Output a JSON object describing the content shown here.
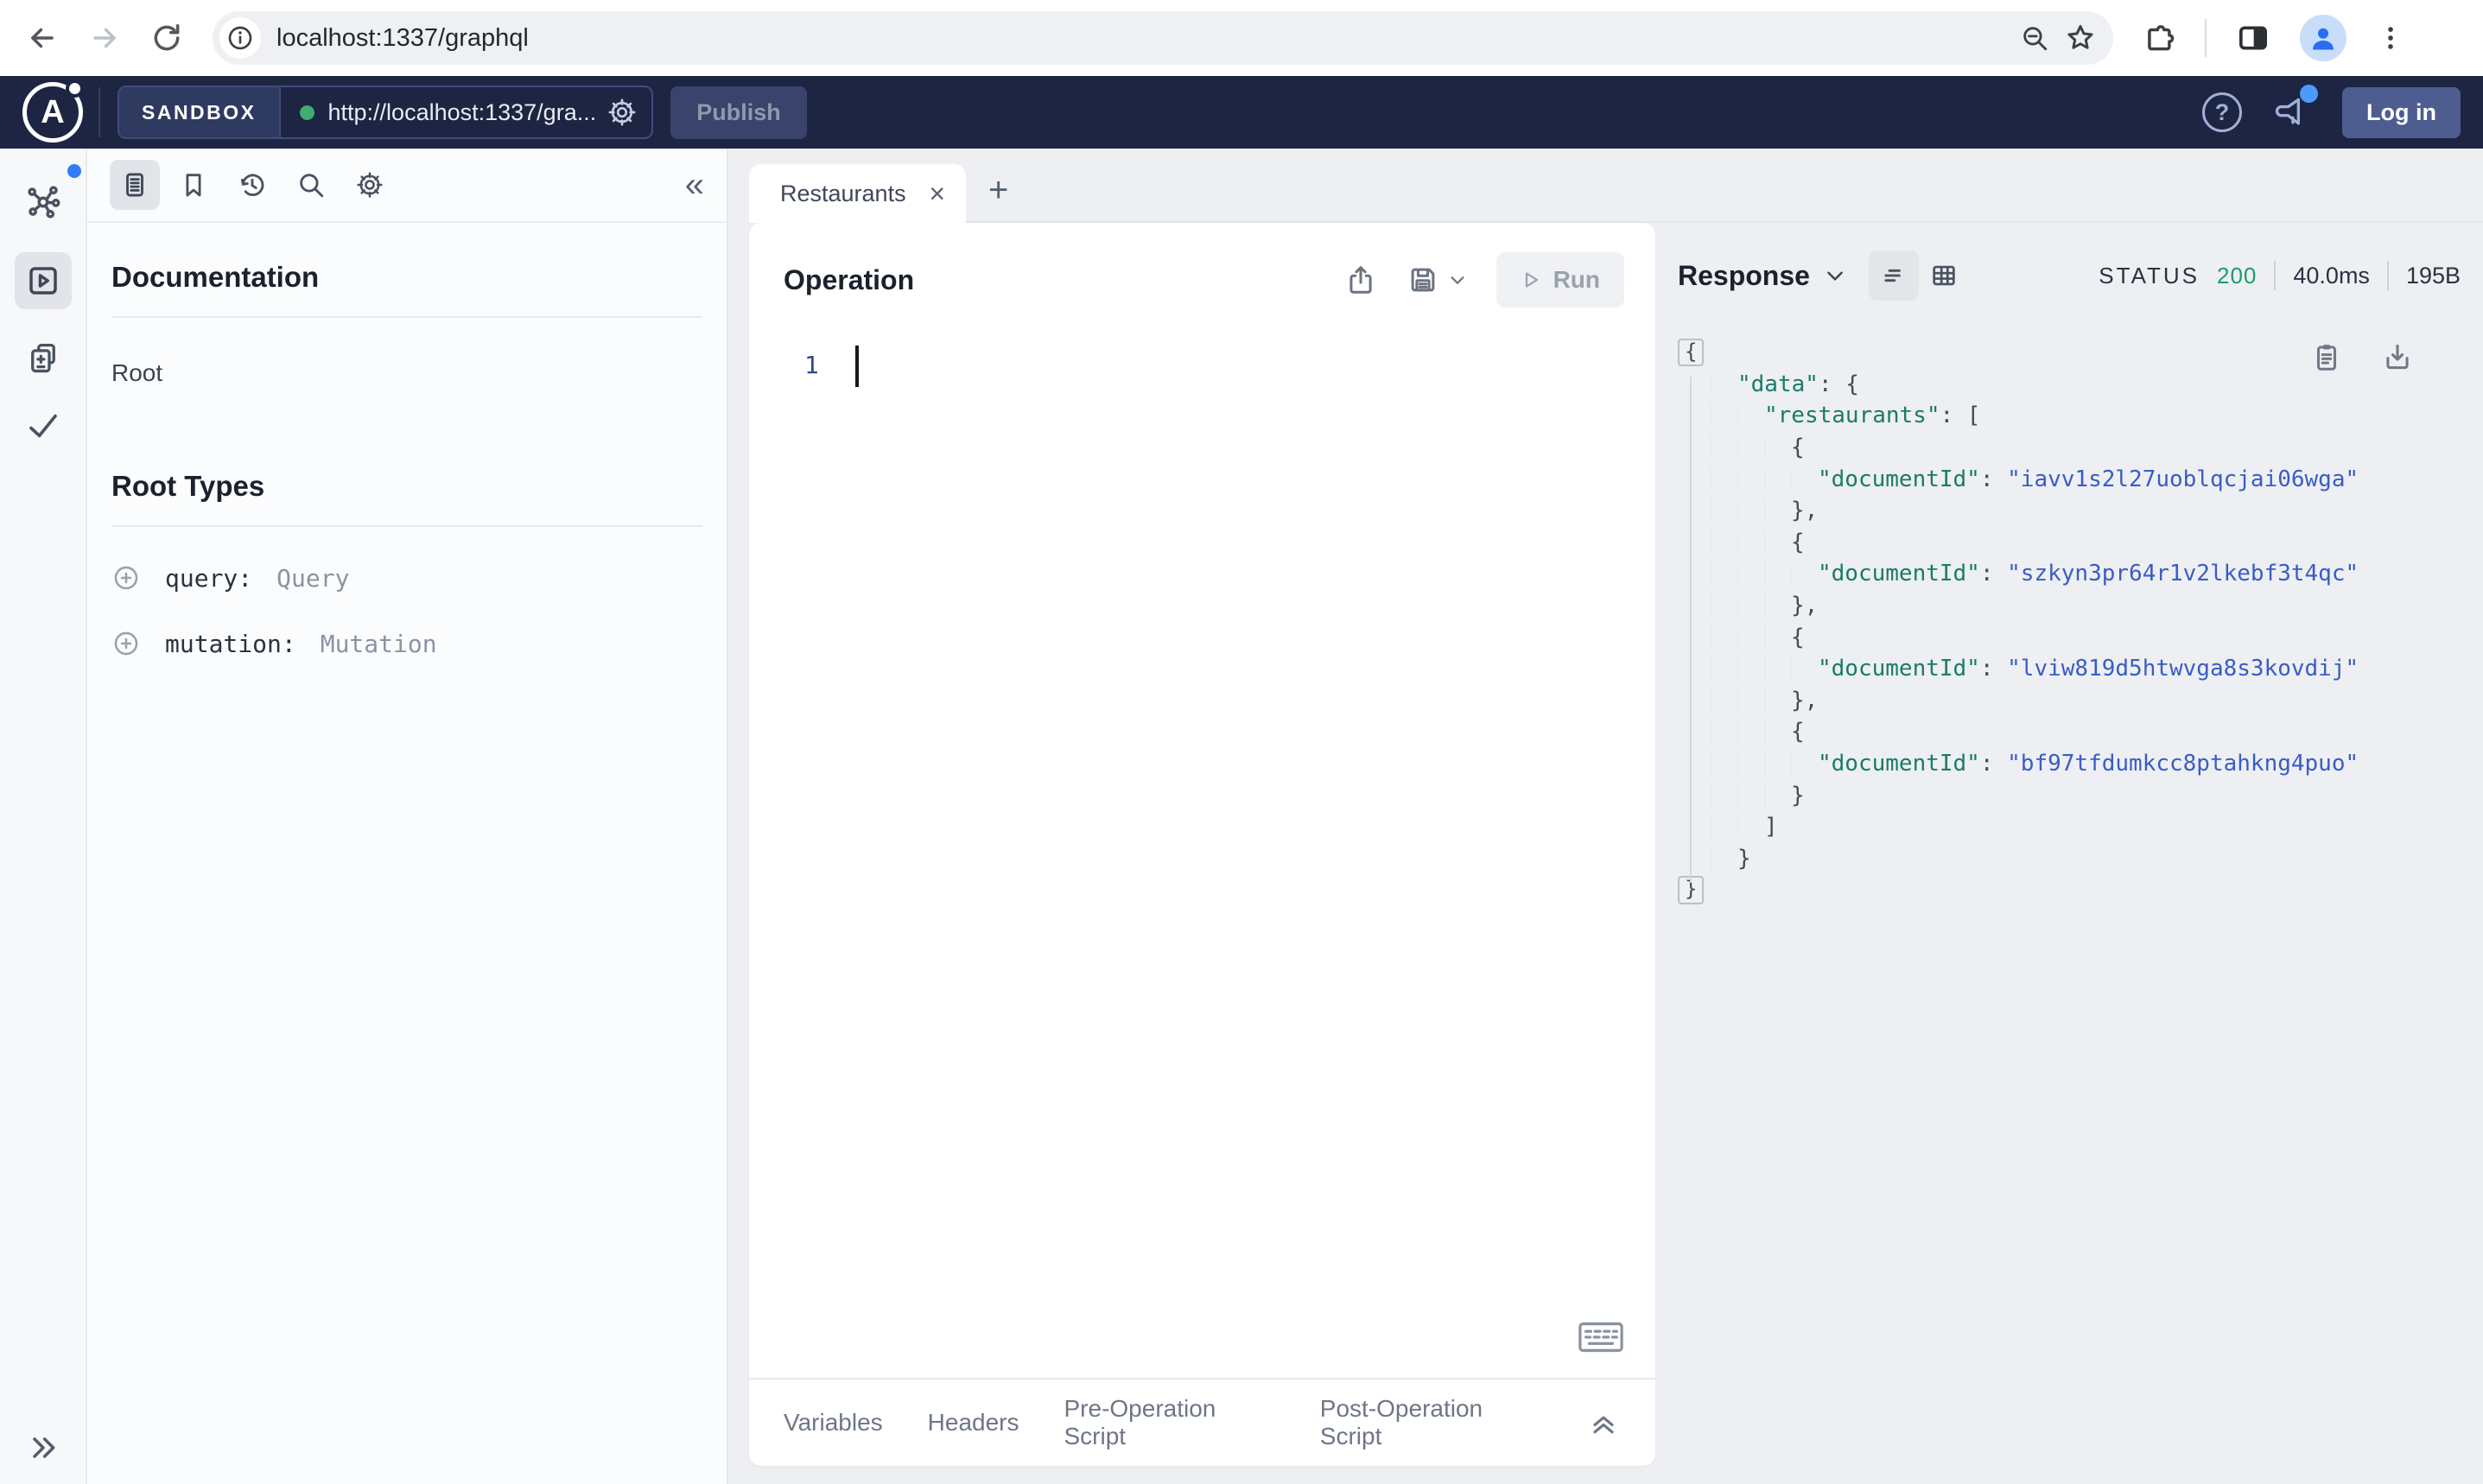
{
  "browser": {
    "url": "localhost:1337/graphql"
  },
  "header": {
    "brand": "SANDBOX",
    "endpoint": "http://localhost:1337/gra...",
    "publish_label": "Publish",
    "login_label": "Log in",
    "help_glyph": "?",
    "colors": {
      "bar_bg": "#1d2543",
      "status_dot": "#3fae6f",
      "notification": "#4c9aff"
    }
  },
  "docs": {
    "title": "Documentation",
    "root_item": "Root",
    "section_title": "Root Types",
    "root_types": [
      {
        "field": "query:",
        "type": "Query"
      },
      {
        "field": "mutation:",
        "type": "Mutation"
      }
    ]
  },
  "tabs": {
    "active_label": "Restaurants",
    "close_glyph": "×",
    "new_tab_glyph": "+"
  },
  "operation": {
    "title": "Operation",
    "run_label": "Run",
    "line_number": "1"
  },
  "bottom_tabs": [
    "Variables",
    "Headers",
    "Pre-Operation Script",
    "Post-Operation Script"
  ],
  "response": {
    "title": "Response",
    "status_label": "STATUS",
    "status_code": "200",
    "time": "40.0ms",
    "size": "195B",
    "colors": {
      "key": "#1a7b68",
      "string": "#3a5cc5",
      "status_ok": "#1b9a6c"
    },
    "lines": [
      {
        "ind": 0,
        "fold": "{",
        "tok": []
      },
      {
        "ind": 1,
        "tok": [
          [
            "k",
            "\"data\""
          ],
          [
            "p",
            ": {"
          ]
        ]
      },
      {
        "ind": 2,
        "tok": [
          [
            "k",
            "\"restaurants\""
          ],
          [
            "p",
            ": ["
          ]
        ]
      },
      {
        "ind": 3,
        "tok": [
          [
            "p",
            "{"
          ]
        ]
      },
      {
        "ind": 4,
        "tok": [
          [
            "k",
            "\"documentId\""
          ],
          [
            "p",
            ": "
          ],
          [
            "s",
            "\"iavv1s2l27uoblqcjai06wga\""
          ]
        ]
      },
      {
        "ind": 3,
        "tok": [
          [
            "p",
            "},"
          ]
        ]
      },
      {
        "ind": 3,
        "tok": [
          [
            "p",
            "{"
          ]
        ]
      },
      {
        "ind": 4,
        "tok": [
          [
            "k",
            "\"documentId\""
          ],
          [
            "p",
            ": "
          ],
          [
            "s",
            "\"szkyn3pr64r1v2lkebf3t4qc\""
          ]
        ]
      },
      {
        "ind": 3,
        "tok": [
          [
            "p",
            "},"
          ]
        ]
      },
      {
        "ind": 3,
        "tok": [
          [
            "p",
            "{"
          ]
        ]
      },
      {
        "ind": 4,
        "tok": [
          [
            "k",
            "\"documentId\""
          ],
          [
            "p",
            ": "
          ],
          [
            "s",
            "\"lviw819d5htwvga8s3kovdij\""
          ]
        ]
      },
      {
        "ind": 3,
        "tok": [
          [
            "p",
            "},"
          ]
        ]
      },
      {
        "ind": 3,
        "tok": [
          [
            "p",
            "{"
          ]
        ]
      },
      {
        "ind": 4,
        "tok": [
          [
            "k",
            "\"documentId\""
          ],
          [
            "p",
            ": "
          ],
          [
            "s",
            "\"bf97tfdumkcc8ptahkng4puo\""
          ]
        ]
      },
      {
        "ind": 3,
        "tok": [
          [
            "p",
            "}"
          ]
        ]
      },
      {
        "ind": 2,
        "tok": [
          [
            "p",
            "]"
          ]
        ]
      },
      {
        "ind": 1,
        "tok": [
          [
            "p",
            "}"
          ]
        ]
      },
      {
        "ind": 0,
        "fold": "}",
        "tok": []
      }
    ]
  },
  "glyphs": {
    "collapse_panel": "«",
    "expand_sidebar": "»"
  }
}
